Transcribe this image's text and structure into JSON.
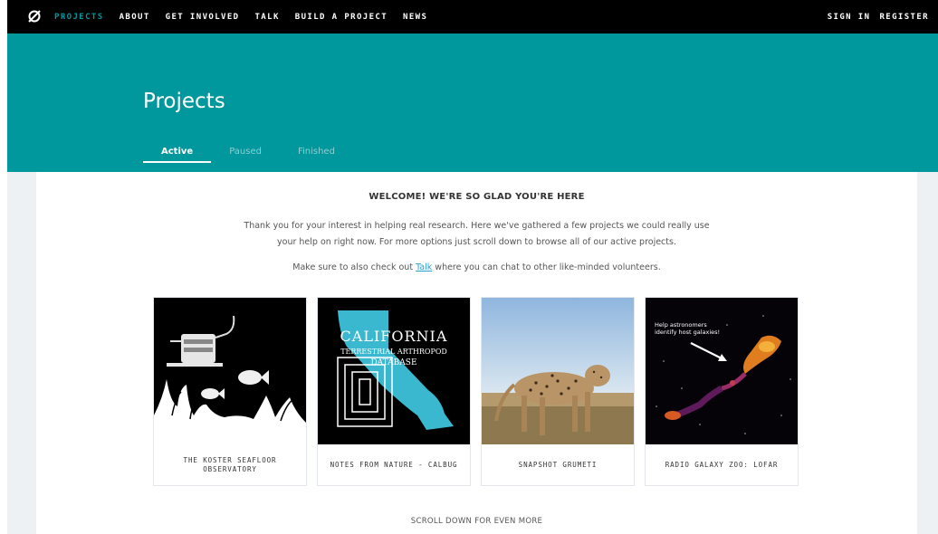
{
  "nav": {
    "logo_icon": "zooniverse-logo-icon",
    "items": [
      {
        "label": "PROJECTS",
        "active": true
      },
      {
        "label": "ABOUT"
      },
      {
        "label": "GET INVOLVED"
      },
      {
        "label": "TALK"
      },
      {
        "label": "BUILD A PROJECT"
      },
      {
        "label": "NEWS"
      }
    ],
    "sign_in": "SIGN IN",
    "register": "REGISTER"
  },
  "hero": {
    "title": "Projects",
    "tabs": [
      {
        "label": "Active",
        "active": true
      },
      {
        "label": "Paused"
      },
      {
        "label": "Finished"
      }
    ]
  },
  "main": {
    "welcome": "WELCOME! WE'RE SO GLAD YOU'RE HERE",
    "intro": "Thank you for your interest in helping real research. Here we've gathered a few projects we could really use your help on right now. For more options just scroll down to browse all of our active projects.",
    "talk_prefix": "Make sure to also check out ",
    "talk_link": "Talk",
    "talk_suffix": " where you can chat to other like-minded volunteers.",
    "scroll_more": "SCROLL DOWN FOR EVEN MORE"
  },
  "projects": [
    {
      "title": "THE KOSTER SEAFLOOR OBSERVATORY"
    },
    {
      "title": "NOTES FROM NATURE - CALBUG",
      "image_text": {
        "line1": "CALIFORNIA",
        "line2": "TERRESTRIAL ARTHROPOD",
        "line3": "DATABASE"
      }
    },
    {
      "title": "SNAPSHOT GRUMETI"
    },
    {
      "title": "RADIO GALAXY ZOO: LOFAR",
      "image_text": {
        "line1": "Help astronomers",
        "line2": "identify host galaxies!"
      }
    }
  ],
  "colors": {
    "teal": "#00979d",
    "nav_bg": "#000000",
    "link": "#2b9fd9"
  }
}
